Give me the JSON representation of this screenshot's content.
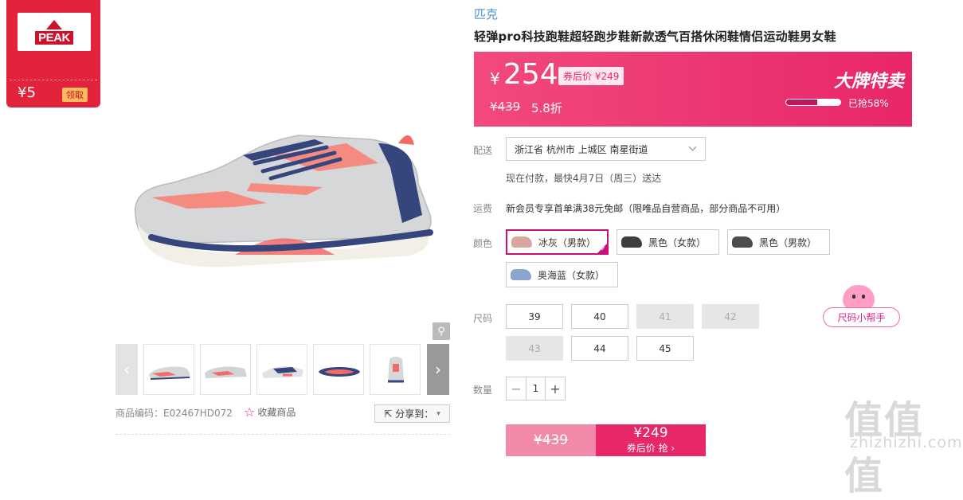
{
  "coupon": {
    "logo_text": "PEAK",
    "amount": "¥5",
    "claim_label": "领取"
  },
  "gallery": {
    "zoom_icon": "magnifier-icon",
    "prev_icon": "chevron-left-icon",
    "next_icon": "chevron-right-icon",
    "thumbnail_count": 5
  },
  "meta": {
    "sku_code": "商品编码：E02467HD072",
    "favorite_label": "收藏商品",
    "share_label": "分享到："
  },
  "product": {
    "brand": "匹克",
    "title": "轻弹pro科技跑鞋超轻跑步鞋新款透气百搭休闲鞋情侣运动鞋男女鞋"
  },
  "price": {
    "currency": "¥",
    "current": "254",
    "after_coupon": "券后价 ¥249",
    "original": "¥439",
    "discount": "5.8折",
    "promo_title": "大牌特卖",
    "sold_fraction": 0.58,
    "sold_text": "已抢58%"
  },
  "shipping": {
    "label": "配送",
    "address": "浙江省 杭州市 上城区 南星街道",
    "note": "现在付款，最快4月7日（周三）送达"
  },
  "freight": {
    "label": "运费",
    "text": "新会员专享首单满38元免邮（限唯品自营商品，部分商品不可用）"
  },
  "colors": {
    "label": "颜色",
    "options": [
      {
        "name": "冰灰（男款）",
        "selected": true,
        "swatch": "#d9a6a0"
      },
      {
        "name": "黑色（女款）",
        "selected": false,
        "swatch": "#3b3f3d"
      },
      {
        "name": "黑色（男款）",
        "selected": false,
        "swatch": "#4a4f4c"
      },
      {
        "name": "奥海蓝（女款）",
        "selected": false,
        "swatch": "#8aa6cf"
      }
    ]
  },
  "sizes": {
    "label": "尺码",
    "options": [
      {
        "value": "39",
        "available": true
      },
      {
        "value": "40",
        "available": true
      },
      {
        "value": "41",
        "available": false
      },
      {
        "value": "42",
        "available": false
      },
      {
        "value": "43",
        "available": false
      },
      {
        "value": "44",
        "available": true
      },
      {
        "value": "45",
        "available": true
      }
    ],
    "helper_label": "尺码小帮手"
  },
  "quantity": {
    "label": "数量",
    "value": "1",
    "minus": "−",
    "plus": "+"
  },
  "buy": {
    "original_price": "¥439",
    "price": "¥249",
    "action": "券后价 抢 ›"
  },
  "watermark": {
    "logo": "值值值",
    "url": "zhizhizhi.com"
  },
  "colors_theme": {
    "accent": "#e8266a",
    "brand_red": "#e2233b",
    "selected_border": "#c8107a"
  }
}
